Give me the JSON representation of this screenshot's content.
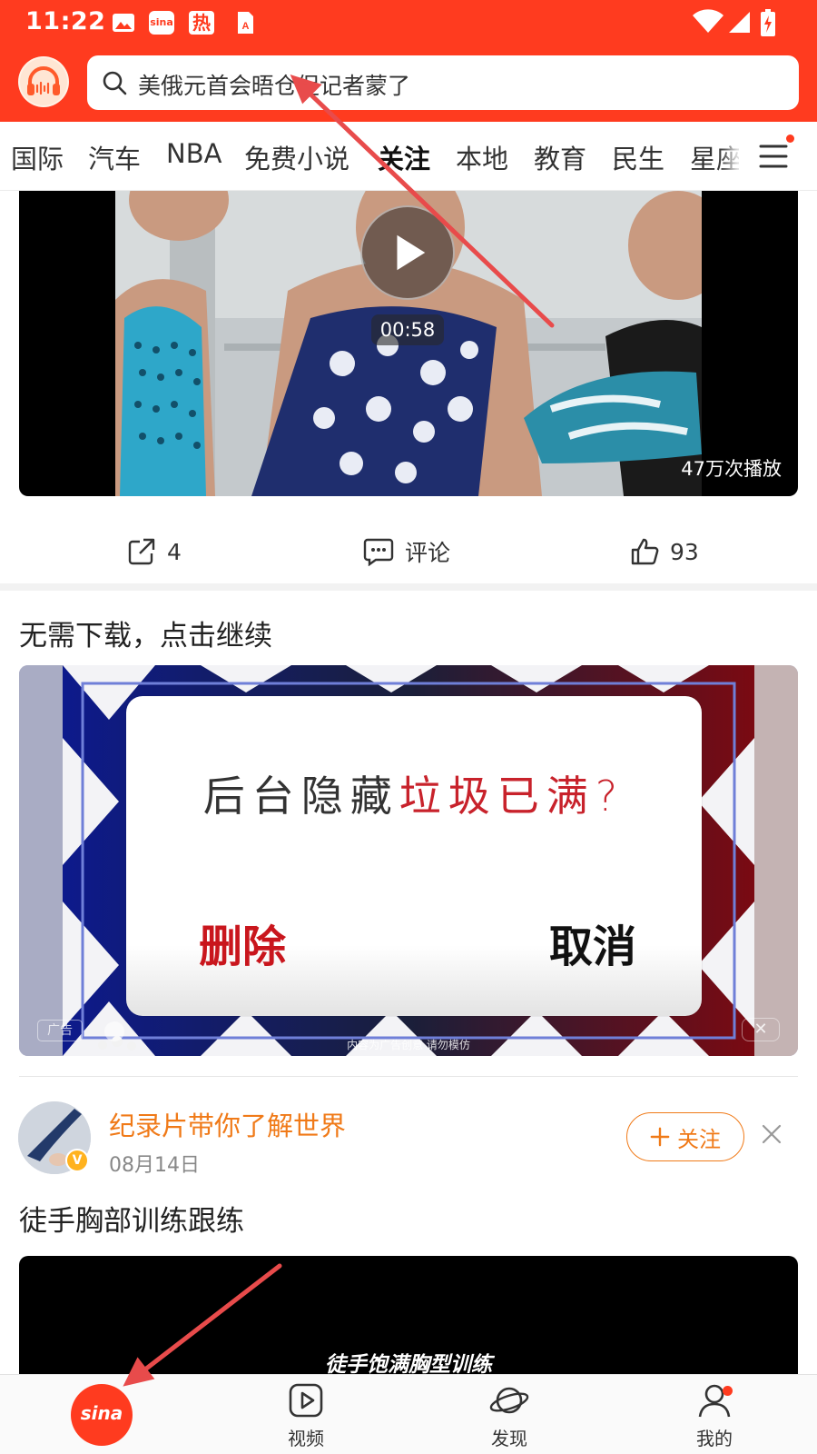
{
  "status_bar": {
    "time": "11:22",
    "notif_sina_label": "sina",
    "notif_hot_label": "热"
  },
  "search": {
    "placeholder": "美俄元首会晤仓促记者蒙了"
  },
  "channel_tabs": [
    {
      "label": "国际",
      "active": false
    },
    {
      "label": "汽车",
      "active": false
    },
    {
      "label": "NBA",
      "active": false
    },
    {
      "label": "免费小说",
      "active": false
    },
    {
      "label": "关注",
      "active": true
    },
    {
      "label": "本地",
      "active": false
    },
    {
      "label": "教育",
      "active": false
    },
    {
      "label": "民生",
      "active": false
    },
    {
      "label": "星座",
      "active": false
    }
  ],
  "video_card": {
    "duration": "00:58",
    "play_count": "47万次播放",
    "share_count": "4",
    "comment_label": "评论",
    "like_count": "93"
  },
  "ad_card": {
    "title": "无需下载，点击继续",
    "question_prefix": "后台隐藏",
    "question_highlight": "垃圾已满?",
    "delete_label": "删除",
    "cancel_label": "取消",
    "tag": "广告",
    "disclaimer": "内容为广告创意 请勿模仿",
    "close_symbol": "✕"
  },
  "post": {
    "author": "纪录片带你了解世界",
    "date": "08月14日",
    "verified_badge": "V",
    "follow_label": "关注",
    "title": "徒手胸部训练跟练",
    "video_caption": "徒手饱满胸型训练"
  },
  "bottom_nav": {
    "home_label": "sina",
    "items": [
      {
        "label": "视频",
        "icon": "video-icon"
      },
      {
        "label": "发现",
        "icon": "planet-icon"
      },
      {
        "label": "我的",
        "icon": "person-icon"
      }
    ]
  },
  "colors": {
    "brand": "#ff3b1f",
    "author": "#f07a18",
    "delete": "#c9161d",
    "annotation": "#e84b4b"
  }
}
